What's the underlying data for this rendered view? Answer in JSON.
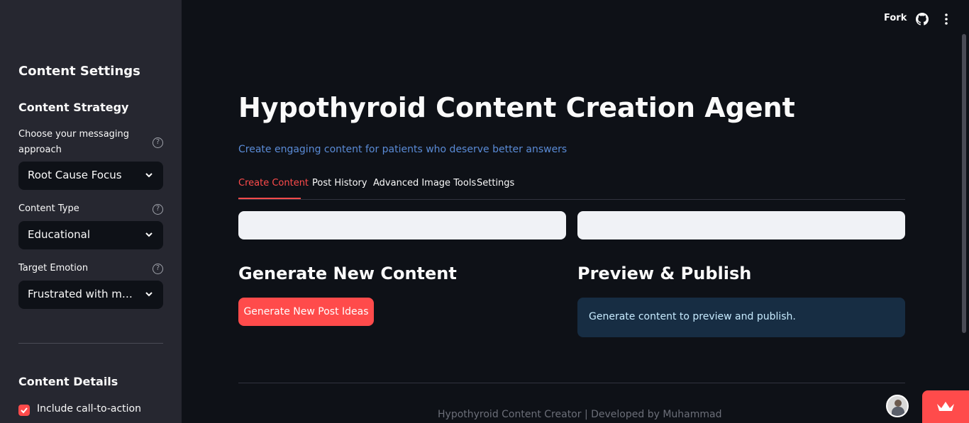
{
  "sidebar": {
    "title": "Content Settings",
    "strategy": {
      "heading": "Content Strategy",
      "messaging_label": "Choose your messaging approach",
      "messaging_value": "Root Cause Focus",
      "type_label": "Content Type",
      "type_value": "Educational",
      "emotion_label": "Target Emotion",
      "emotion_value": "Frustrated with me..."
    },
    "details": {
      "heading": "Content Details",
      "cta_label": "Include call-to-action",
      "cta_checked": true
    }
  },
  "header": {
    "fork_label": "Fork"
  },
  "main": {
    "title": "Hypothyroid Content Creation Agent",
    "subtitle": "Create engaging content for patients who deserve better answers",
    "tabs": [
      {
        "label": "Create Content",
        "active": true
      },
      {
        "label": "Post History",
        "active": false
      },
      {
        "label": "Advanced Image Tools",
        "active": false
      },
      {
        "label": "Settings",
        "active": false
      }
    ],
    "generate": {
      "heading": "Generate New Content",
      "button_label": "Generate New Post Ideas"
    },
    "preview": {
      "heading": "Preview & Publish",
      "info_text": "Generate content to preview and publish."
    }
  },
  "footer": {
    "text": "Hypothyroid Content Creator | Developed by Muhammad"
  },
  "colors": {
    "accent": "#ff4b4b",
    "background": "#0e1117",
    "sidebar": "#262730",
    "info_bg": "#172d43",
    "subtitle": "#5a8bd6"
  },
  "icons": [
    "help-icon",
    "chevron-down-icon",
    "github-icon",
    "more-vert-icon",
    "crown-icon",
    "checkmark-icon"
  ]
}
